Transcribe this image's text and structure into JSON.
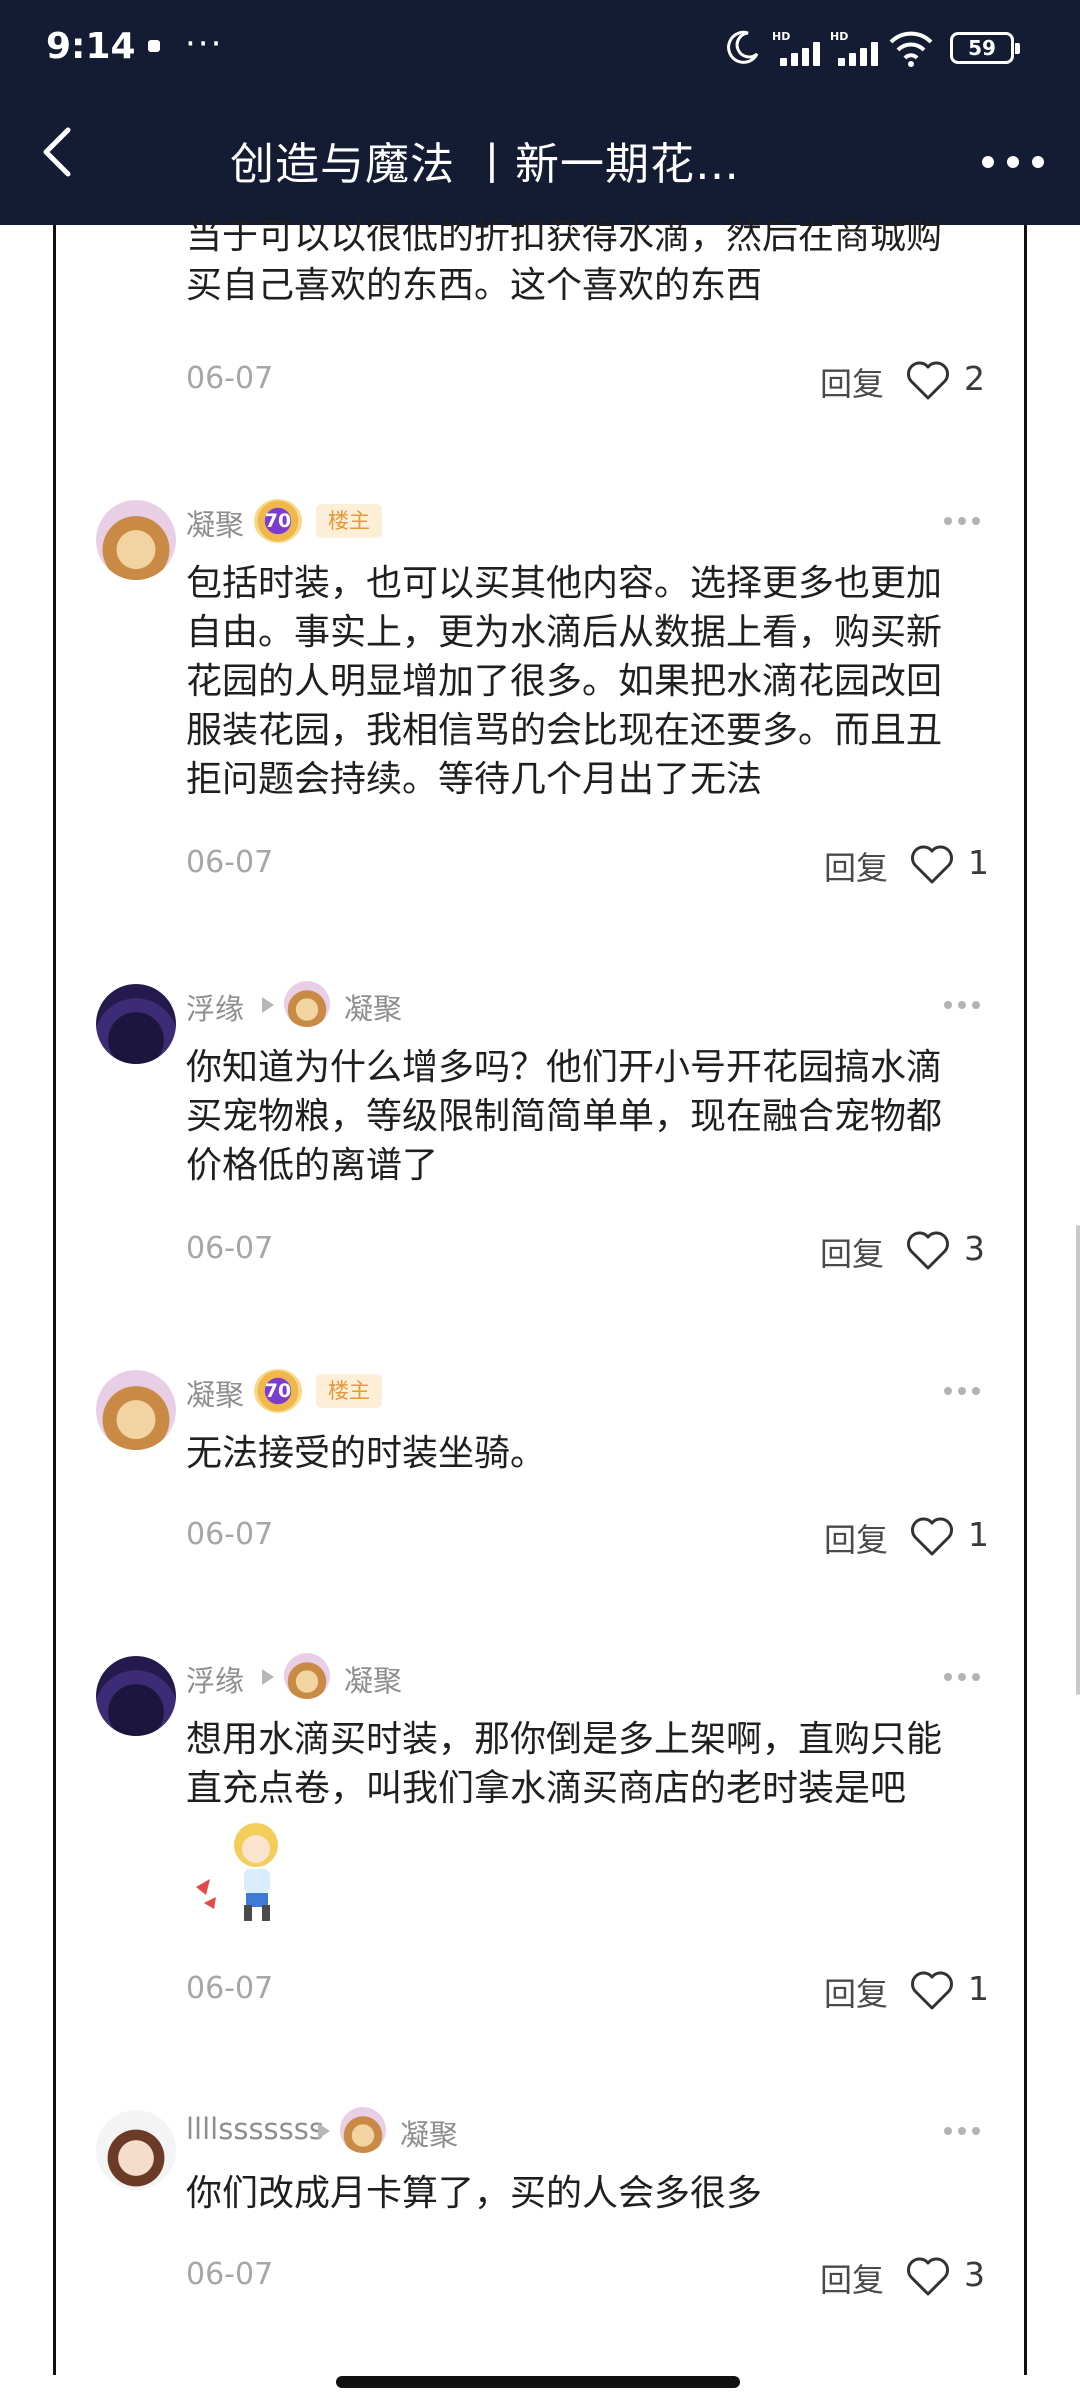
{
  "status_bar": {
    "time": "9:14",
    "dots": "···",
    "hd1": "HD",
    "hd2": "HD",
    "battery": "59"
  },
  "nav": {
    "title": "创造与魔法 丨新一期花…"
  },
  "comments": [
    {
      "id": "c0",
      "text_lines": [
        "当于可以以很低的折扣获得水滴，然后在商城购",
        "买自己喜欢的东西。这个喜欢的东西"
      ],
      "date": "06-07",
      "reply": "回复",
      "likes": "2"
    },
    {
      "id": "c1",
      "author": "凝聚",
      "level": "70",
      "tag": "楼主",
      "text_lines": [
        "包括时装，也可以买其他内容。选择更多也更加",
        "自由。事实上，更为水滴后从数据上看，购买新",
        "花园的人明显增加了很多。如果把水滴花园改回",
        "服装花园，我相信骂的会比现在还要多。而且丑",
        "拒问题会持续。等待几个月出了无法"
      ],
      "date": "06-07",
      "reply": "回复",
      "likes": "1"
    },
    {
      "id": "c2",
      "author": "浮缘",
      "reply_to": "凝聚",
      "text_lines": [
        "你知道为什么增多吗？他们开小号开花园搞水滴",
        "买宠物粮，等级限制简简单单，现在融合宠物都",
        "价格低的离谱了"
      ],
      "date": "06-07",
      "reply": "回复",
      "likes": "3"
    },
    {
      "id": "c3",
      "author": "凝聚",
      "level": "70",
      "tag": "楼主",
      "text_lines": [
        "无法接受的时装坐骑。"
      ],
      "date": "06-07",
      "reply": "回复",
      "likes": "1"
    },
    {
      "id": "c4",
      "author": "浮缘",
      "reply_to": "凝聚",
      "text_lines": [
        "想用水滴买时装，那你倒是多上架啊，直购只能",
        "直充点卷，叫我们拿水滴买商店的老时装是吧"
      ],
      "sticker": "angry-girl-sticker",
      "date": "06-07",
      "reply": "回复",
      "likes": "1"
    },
    {
      "id": "c5",
      "author": "llllsssssss",
      "reply_to": "凝聚",
      "text_lines": [
        "你们改成月卡算了，买的人会多很多"
      ],
      "date": "06-07",
      "reply": "回复",
      "likes": "3"
    }
  ],
  "colors": {
    "header_bg": "#141c33",
    "text": "#1f1f1f",
    "meta": "#a6a6a6",
    "owner_tag_bg": "#fdeed8",
    "owner_tag_fg": "#e39a3a"
  }
}
